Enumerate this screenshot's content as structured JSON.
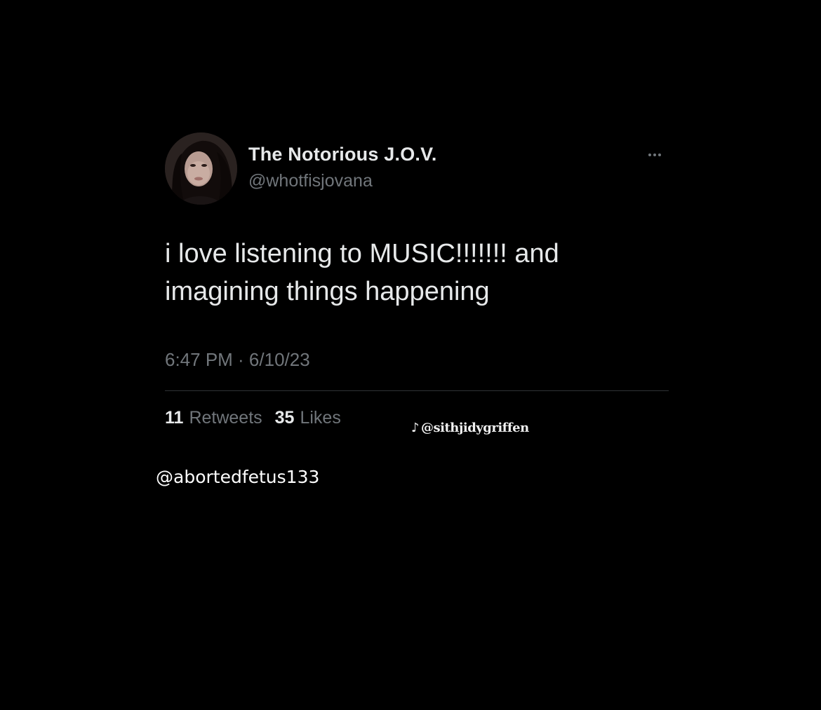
{
  "tweet": {
    "display_name": "The Notorious J.O.V.",
    "handle": "@whotfisjovana",
    "text": "i love listening to MUSIC!!!!!!! and\nimagining things happening",
    "timestamp": "6:47 PM · 6/10/23",
    "more_icon": "more-horizontal-icon",
    "stats": [
      {
        "count": "11",
        "label": "Retweets"
      },
      {
        "count": "35",
        "label": "Likes"
      }
    ]
  },
  "watermark": {
    "icon": "tiktok-icon",
    "text": "@sithjidygriffen"
  },
  "credit": "@abortedfetus133",
  "colors": {
    "background": "#000000",
    "primary_text": "#e7e9ea",
    "secondary_text": "#71767b",
    "divider": "#2f3336"
  }
}
